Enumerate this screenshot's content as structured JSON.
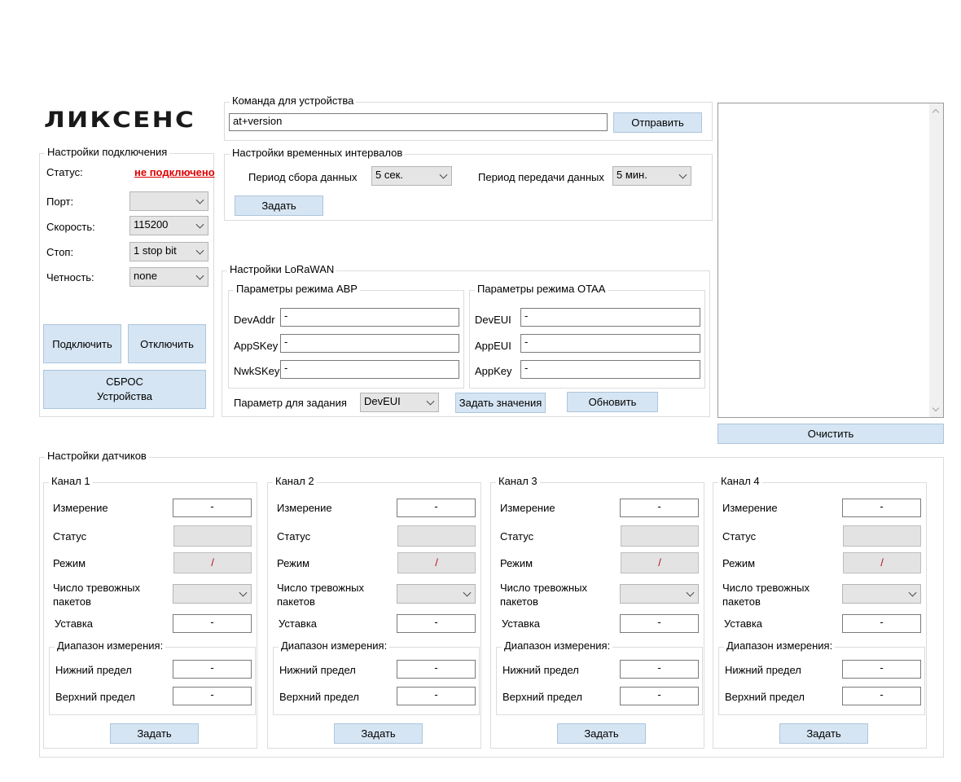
{
  "logo": {
    "text": "ЛИКСЕНС"
  },
  "command": {
    "group_label": "Команда для устройства",
    "input_value": "at+version",
    "send_label": "Отправить"
  },
  "connection": {
    "group_label": "Настройки подключения",
    "status_label": "Статус:",
    "status_value": "не подключено",
    "status_color": "#e00000",
    "port_label": "Порт:",
    "port_value": "",
    "speed_label": "Скорость:",
    "speed_value": "115200",
    "stop_label": "Стоп:",
    "stop_value": "1 stop bit",
    "parity_label": "Четность:",
    "parity_value": "none",
    "connect_label": "Подключить",
    "disconnect_label": "Отключить",
    "reset_line1": "СБРОС",
    "reset_line2": "Устройства"
  },
  "intervals": {
    "group_label": "Настройки временных интервалов",
    "collect_label": "Период сбора данных",
    "collect_value": "5 сек.",
    "transmit_label": "Период передачи данных",
    "transmit_value": "5 мин.",
    "set_label": "Задать"
  },
  "lorawan": {
    "group_label": "Настройки LoRaWAN",
    "abp": {
      "group_label": "Параметры режима ABP",
      "devaddr_label": "DevAddr",
      "devaddr_value": "-",
      "appskey_label": "AppSKey",
      "appskey_value": "-",
      "nwkskey_label": "NwkSKey",
      "nwkskey_value": "-"
    },
    "otaa": {
      "group_label": "Параметры режима OTAA",
      "deveui_label": "DevEUI",
      "deveui_value": "-",
      "appeui_label": "AppEUI",
      "appeui_value": "-",
      "appkey_label": "AppKey",
      "appkey_value": "-"
    },
    "param_label": "Параметр для задания",
    "param_value": "DevEUI",
    "set_values_label": "Задать значения",
    "refresh_label": "Обновить"
  },
  "log": {
    "clear_label": "Очистить"
  },
  "sensors": {
    "group_label": "Настройки датчиков",
    "channels": [
      {
        "title": "Канал 1",
        "measure_label": "Измерение",
        "measure_value": "-",
        "status_label": "Статус",
        "mode_label": "Режим",
        "mode_value": "/",
        "alarm_label_1": "Число тревожных",
        "alarm_label_2": "пакетов",
        "setpoint_label": "Уставка",
        "setpoint_value": "-",
        "range_label": "Диапазон измерения:",
        "lower_label": "Нижний предел",
        "lower_value": "-",
        "upper_label": "Верхний предел",
        "upper_value": "-",
        "set_label": "Задать"
      },
      {
        "title": "Канал 2",
        "measure_label": "Измерение",
        "measure_value": "-",
        "status_label": "Статус",
        "mode_label": "Режим",
        "mode_value": "/",
        "alarm_label_1": "Число тревожных",
        "alarm_label_2": "пакетов",
        "setpoint_label": "Уставка",
        "setpoint_value": "-",
        "range_label": "Диапазон измерения:",
        "lower_label": "Нижний предел",
        "lower_value": "-",
        "upper_label": "Верхний предел",
        "upper_value": "-",
        "set_label": "Задать"
      },
      {
        "title": "Канал 3",
        "measure_label": "Измерение",
        "measure_value": "-",
        "status_label": "Статус",
        "mode_label": "Режим",
        "mode_value": "/",
        "alarm_label_1": "Число тревожных",
        "alarm_label_2": "пакетов",
        "setpoint_label": "Уставка",
        "setpoint_value": "-",
        "range_label": "Диапазон измерения:",
        "lower_label": "Нижний предел",
        "lower_value": "-",
        "upper_label": "Верхний предел",
        "upper_value": "-",
        "set_label": "Задать"
      },
      {
        "title": "Канал 4",
        "measure_label": "Измерение",
        "measure_value": "-",
        "status_label": "Статус",
        "mode_label": "Режим",
        "mode_value": "/",
        "alarm_label_1": "Число тревожных",
        "alarm_label_2": "пакетов",
        "setpoint_label": "Уставка",
        "setpoint_value": "-",
        "range_label": "Диапазон измерения:",
        "lower_label": "Нижний предел",
        "lower_value": "-",
        "upper_label": "Верхний предел",
        "upper_value": "-",
        "set_label": "Задать"
      }
    ]
  }
}
